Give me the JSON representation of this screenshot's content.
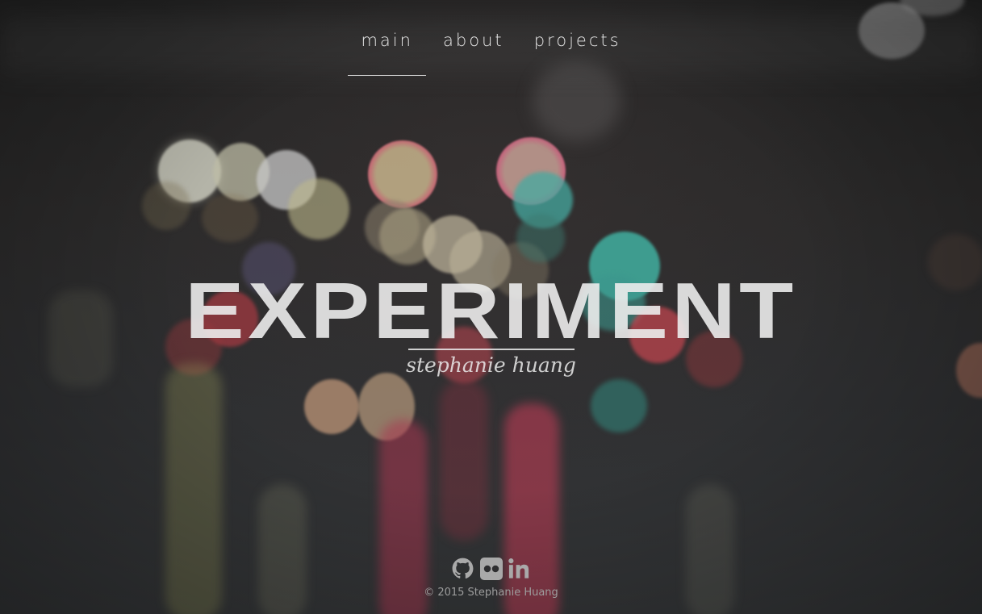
{
  "nav": {
    "items": [
      {
        "label": "main",
        "active": true
      },
      {
        "label": "about",
        "active": false
      },
      {
        "label": "projects",
        "active": false
      }
    ]
  },
  "hero": {
    "title": "EXPERIMENT",
    "subtitle": "stephanie huang"
  },
  "footer": {
    "social_icons": [
      "github-icon",
      "flickr-icon",
      "linkedin-icon"
    ],
    "copyright": "© 2015 Stephanie Huang"
  },
  "colors": {
    "text": "#e6e6e6",
    "footer_text": "#9d9d9d",
    "icon": "#a9a9a9",
    "background": "#2a2a2b"
  }
}
